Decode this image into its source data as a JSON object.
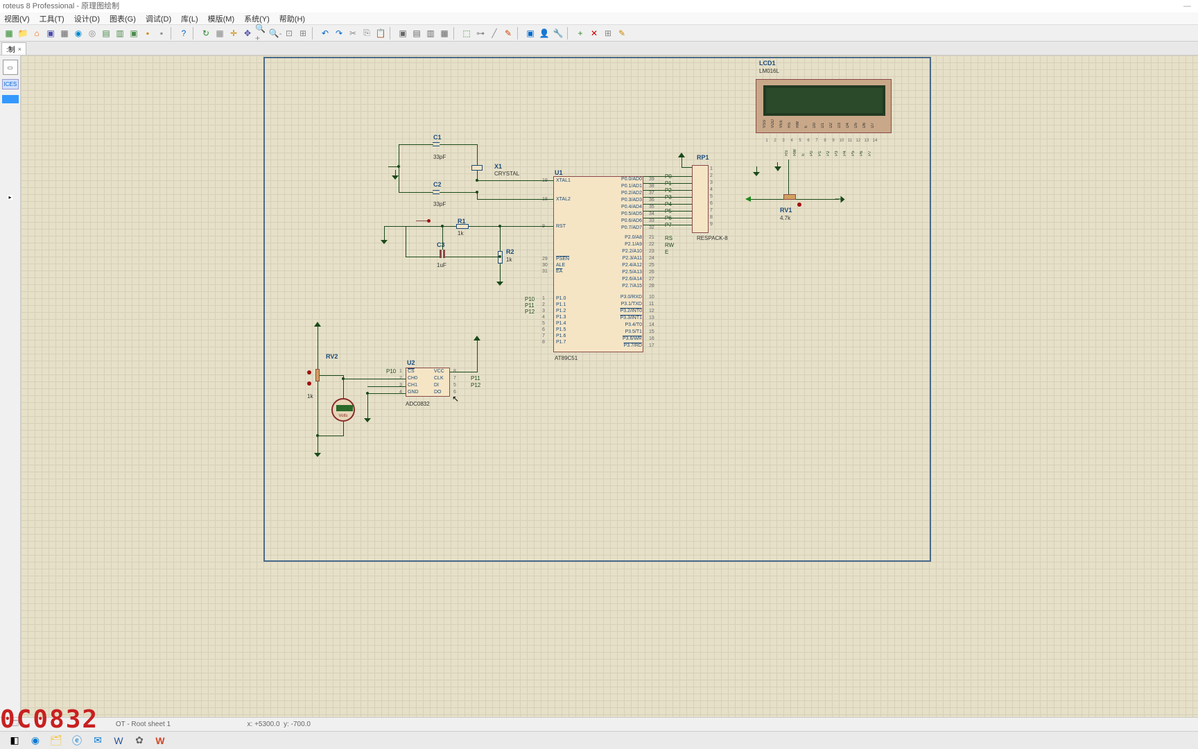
{
  "app": {
    "title": "roteus 8 Professional - 原理图绘制",
    "min": "—"
  },
  "menu": [
    "视图(V)",
    "工具(T)",
    "设计(D)",
    "图表(G)",
    "调试(D)",
    "库(L)",
    "模版(M)",
    "系统(Y)",
    "帮助(H)"
  ],
  "tab": {
    "label": ":制",
    "close": "×"
  },
  "sidebar": {
    "devices": "ICES"
  },
  "status": {
    "sheet": "OT - Root sheet 1",
    "x_label": "x:",
    "x_val": "+5300.0",
    "y_label": "y:",
    "y_val": "-700.0"
  },
  "watermark": "0C0832",
  "components": {
    "c1": {
      "ref": "C1",
      "val": "33pF"
    },
    "c2": {
      "ref": "C2",
      "val": "33pF"
    },
    "c3": {
      "ref": "C3",
      "val": "1uF"
    },
    "x1": {
      "ref": "X1",
      "val": "CRYSTAL"
    },
    "r1": {
      "ref": "R1",
      "val": "1k"
    },
    "r2": {
      "ref": "R2",
      "val": "1k"
    },
    "u1": {
      "ref": "U1",
      "val": "AT89C51"
    },
    "u2": {
      "ref": "U2",
      "val": "ADC0832"
    },
    "rp1": {
      "ref": "RP1",
      "val": "RESPACK-8"
    },
    "rv1": {
      "ref": "RV1",
      "val": "4.7k"
    },
    "rv2": {
      "ref": "RV2",
      "val": "1k"
    },
    "lcd1": {
      "ref": "LCD1",
      "val": "LM016L"
    },
    "voltmeter": {
      "label": "Volts"
    }
  },
  "u1_pins_left": [
    {
      "n": "19",
      "t": "XTAL1"
    },
    {
      "n": "18",
      "t": "XTAL2"
    },
    {
      "n": "9",
      "t": "RST"
    },
    {
      "n": "29",
      "t": "PSEN",
      "bar": true
    },
    {
      "n": "30",
      "t": "ALE"
    },
    {
      "n": "31",
      "t": "EA",
      "bar": true
    },
    {
      "n": "1",
      "t": "P1.0"
    },
    {
      "n": "2",
      "t": "P1.1"
    },
    {
      "n": "3",
      "t": "P1.2"
    },
    {
      "n": "4",
      "t": "P1.3"
    },
    {
      "n": "5",
      "t": "P1.4"
    },
    {
      "n": "6",
      "t": "P1.5"
    },
    {
      "n": "7",
      "t": "P1.6"
    },
    {
      "n": "8",
      "t": "P1.7"
    }
  ],
  "u1_pins_right_p0": [
    {
      "n": "39",
      "t": "P0.0/AD0"
    },
    {
      "n": "38",
      "t": "P0.1/AD1"
    },
    {
      "n": "37",
      "t": "P0.2/AD2"
    },
    {
      "n": "36",
      "t": "P0.3/AD3"
    },
    {
      "n": "35",
      "t": "P0.4/AD4"
    },
    {
      "n": "34",
      "t": "P0.5/AD5"
    },
    {
      "n": "33",
      "t": "P0.6/AD6"
    },
    {
      "n": "32",
      "t": "P0.7/AD7"
    }
  ],
  "u1_pins_right_p2": [
    {
      "n": "21",
      "t": "P2.0/A8"
    },
    {
      "n": "22",
      "t": "P2.1/A9"
    },
    {
      "n": "23",
      "t": "P2.2/A10"
    },
    {
      "n": "24",
      "t": "P2.3/A11"
    },
    {
      "n": "25",
      "t": "P2.4/A12"
    },
    {
      "n": "26",
      "t": "P2.5/A13"
    },
    {
      "n": "27",
      "t": "P2.6/A14"
    },
    {
      "n": "28",
      "t": "P2.7/A15"
    }
  ],
  "u1_pins_right_p3": [
    {
      "n": "10",
      "t": "P3.0/RXD"
    },
    {
      "n": "11",
      "t": "P3.1/TXD"
    },
    {
      "n": "12",
      "t": "P3.2/INT0",
      "bar": true
    },
    {
      "n": "13",
      "t": "P3.3/INT1",
      "bar": true
    },
    {
      "n": "14",
      "t": "P3.4/T0"
    },
    {
      "n": "15",
      "t": "P3.5/T1"
    },
    {
      "n": "16",
      "t": "P3.6/WR",
      "bar": true
    },
    {
      "n": "17",
      "t": "P3.7/RD",
      "bar": true
    }
  ],
  "u2_pins_left": [
    {
      "n": "1",
      "t": "CS",
      "bar": true
    },
    {
      "n": "2",
      "t": "CH0"
    },
    {
      "n": "3",
      "t": "CH1"
    },
    {
      "n": "4",
      "t": "GND"
    }
  ],
  "u2_pins_right": [
    {
      "n": "8",
      "t": "VCC"
    },
    {
      "n": "7",
      "t": "CLK"
    },
    {
      "n": "5",
      "t": "DI"
    },
    {
      "n": "6",
      "t": "DO"
    }
  ],
  "rp1_nets_left": [
    "P0",
    "P1",
    "P2",
    "P3",
    "P4",
    "P5",
    "P6",
    "P7"
  ],
  "rp1_pins_right": [
    "1",
    "2",
    "3",
    "4",
    "5",
    "6",
    "7",
    "8",
    "9"
  ],
  "rp1_nets_rs": [
    "RS",
    "RW",
    "E"
  ],
  "p1_nets": [
    "P10",
    "P11",
    "P12"
  ],
  "u2_nets_right": [
    "P11",
    "P12"
  ],
  "u2_net_cs": "P10",
  "lcd_pins": [
    "VSS",
    "VDD",
    "VEE",
    "RS",
    "RW",
    "E",
    "D0",
    "D1",
    "D2",
    "D3",
    "D4",
    "D5",
    "D6",
    "D7"
  ],
  "lcd_pin_nums": [
    "1",
    "2",
    "3",
    "4",
    "5",
    "6",
    "7",
    "8",
    "9",
    "10",
    "11",
    "12",
    "13",
    "14"
  ],
  "lcd_nets": [
    "RS",
    "RW",
    "E",
    "P0",
    "P1",
    "P2",
    "P3",
    "P4",
    "P5",
    "P6",
    "P7"
  ]
}
